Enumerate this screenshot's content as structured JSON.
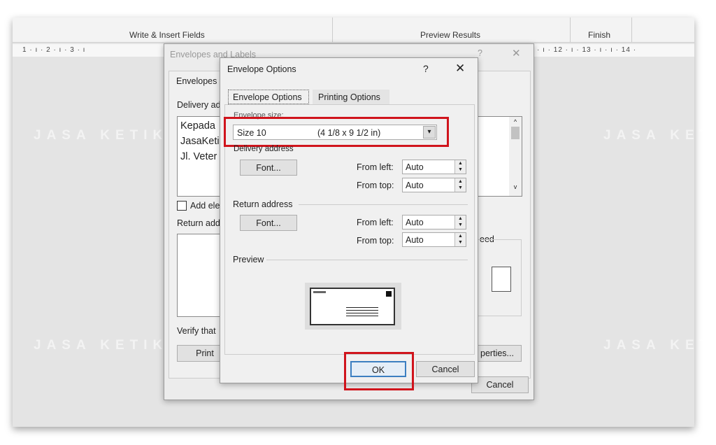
{
  "ribbon": {
    "groups": [
      "Write & Insert Fields",
      "Preview Results",
      "Finish"
    ]
  },
  "ruler": {
    "left": "1 · ı · 2 · ı · 3 · ı",
    "right": "· ı · 12 · ı · 13 · ı · ı · 14 ·"
  },
  "bg_dialog": {
    "title": "Envelopes and Labels",
    "help": "?",
    "close": "✕",
    "tab": "Envelopes",
    "delivery_label": "Delivery ad",
    "address_lines": [
      "Kepada",
      "JasaKeti",
      "Jl. Veter"
    ],
    "add_checkbox": "Add ele",
    "return_label": "Return add",
    "verify": "Verify that",
    "print": "Print",
    "feed": "eed",
    "properties": "perties...",
    "cancel": "Cancel"
  },
  "dialog": {
    "title": "Envelope Options",
    "help": "?",
    "close": "✕",
    "tabs": [
      {
        "label": "Envelope Options",
        "active": true
      },
      {
        "label": "Printing Options",
        "active": false
      }
    ],
    "envelope_size_label": "Envelope size:",
    "envelope_size_value": "Size 10",
    "envelope_size_dims": "(4 1/8 x 9 1/2 in)",
    "delivery": {
      "label": "Delivery address",
      "font": "Font...",
      "from_left_label": "From left:",
      "from_left": "Auto",
      "from_top_label": "From top:",
      "from_top": "Auto"
    },
    "return": {
      "label": "Return address",
      "font": "Font...",
      "from_left_label": "From left:",
      "from_left": "Auto",
      "from_top_label": "From top:",
      "from_top": "Auto"
    },
    "preview_label": "Preview",
    "ok": "OK",
    "cancel": "Cancel"
  },
  "highlight_color": "#d0141c",
  "watermark": "JASA KETIKIN.COM"
}
